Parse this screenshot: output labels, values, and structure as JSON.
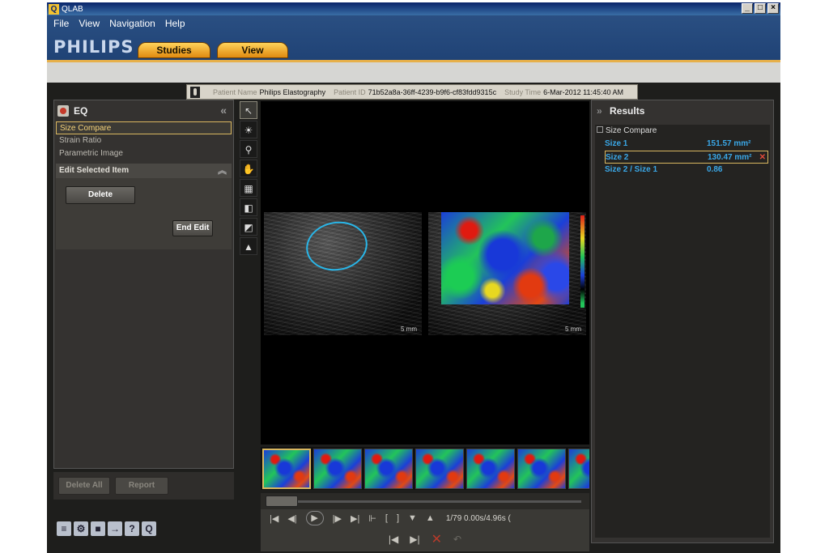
{
  "window": {
    "title": "QLAB"
  },
  "menu": [
    "File",
    "View",
    "Navigation",
    "Help"
  ],
  "brand": {
    "logo": "PHILIPS"
  },
  "nav_tabs": [
    "Studies",
    "View"
  ],
  "patient": {
    "name_label": "Patient Name",
    "name": "Philips Elastography",
    "id_label": "Patient ID",
    "id": "71b52a8a-36ff-4239-b9f6-cf83fdd9315c",
    "time_label": "Study Time",
    "time": "6-Mar-2012 11:45:40 AM"
  },
  "left_panel": {
    "title": "EQ",
    "tools": [
      "Size Compare",
      "Strain Ratio",
      "Parametric Image"
    ],
    "selected_tool": "Size Compare",
    "edit_section": "Edit Selected Item",
    "delete_label": "Delete",
    "end_edit_label": "End Edit",
    "delete_all_label": "Delete All",
    "report_label": "Report"
  },
  "viewer": {
    "scale_left": "5 mm",
    "scale_right": "5 mm"
  },
  "playback": {
    "frame_info": "1/79  0.00s/4.96s ("
  },
  "results": {
    "title": "Results",
    "group": "Size Compare",
    "rows": [
      {
        "label": "Size 1",
        "value": "151.57 mm²"
      },
      {
        "label": "Size 2",
        "value": "130.47 mm²"
      },
      {
        "label": "Size 2 / Size 1",
        "value": "0.86"
      }
    ]
  },
  "colors": {
    "accent": "#d9b760",
    "results_text": "#3aa8e8",
    "header_blue": "#234a7d"
  }
}
